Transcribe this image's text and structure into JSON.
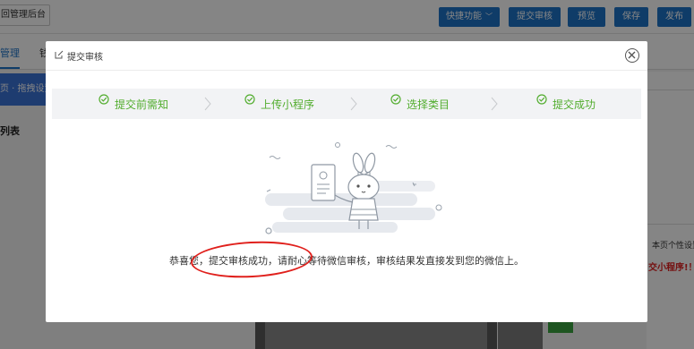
{
  "background": {
    "admin_button": "回管理后台",
    "toolbar": {
      "quick_functions": "快捷功能",
      "submit_review": "提交审核",
      "preview": "预览",
      "save": "保存",
      "publish": "发布"
    },
    "subtabs": [
      "管理",
      "钱"
    ],
    "side_nav_item": "页 · 拖拽设置",
    "list_title": "列表",
    "right_panel_text": "本页个性设置",
    "right_panel_red": "交小程序!！",
    "accent": "#1e73c8"
  },
  "modal": {
    "title": "提交审核",
    "steps": [
      {
        "label": "提交前需知",
        "done": true
      },
      {
        "label": "上传小程序",
        "done": true
      },
      {
        "label": "选择类目",
        "done": true
      },
      {
        "label": "提交成功",
        "done": true
      }
    ],
    "step_color": "#52ad2e",
    "message": "恭喜您，提交审核成功，请耐心等待微信审核，审核结果发直接发到您的微信上。",
    "highlight_color": "#e0201c"
  }
}
